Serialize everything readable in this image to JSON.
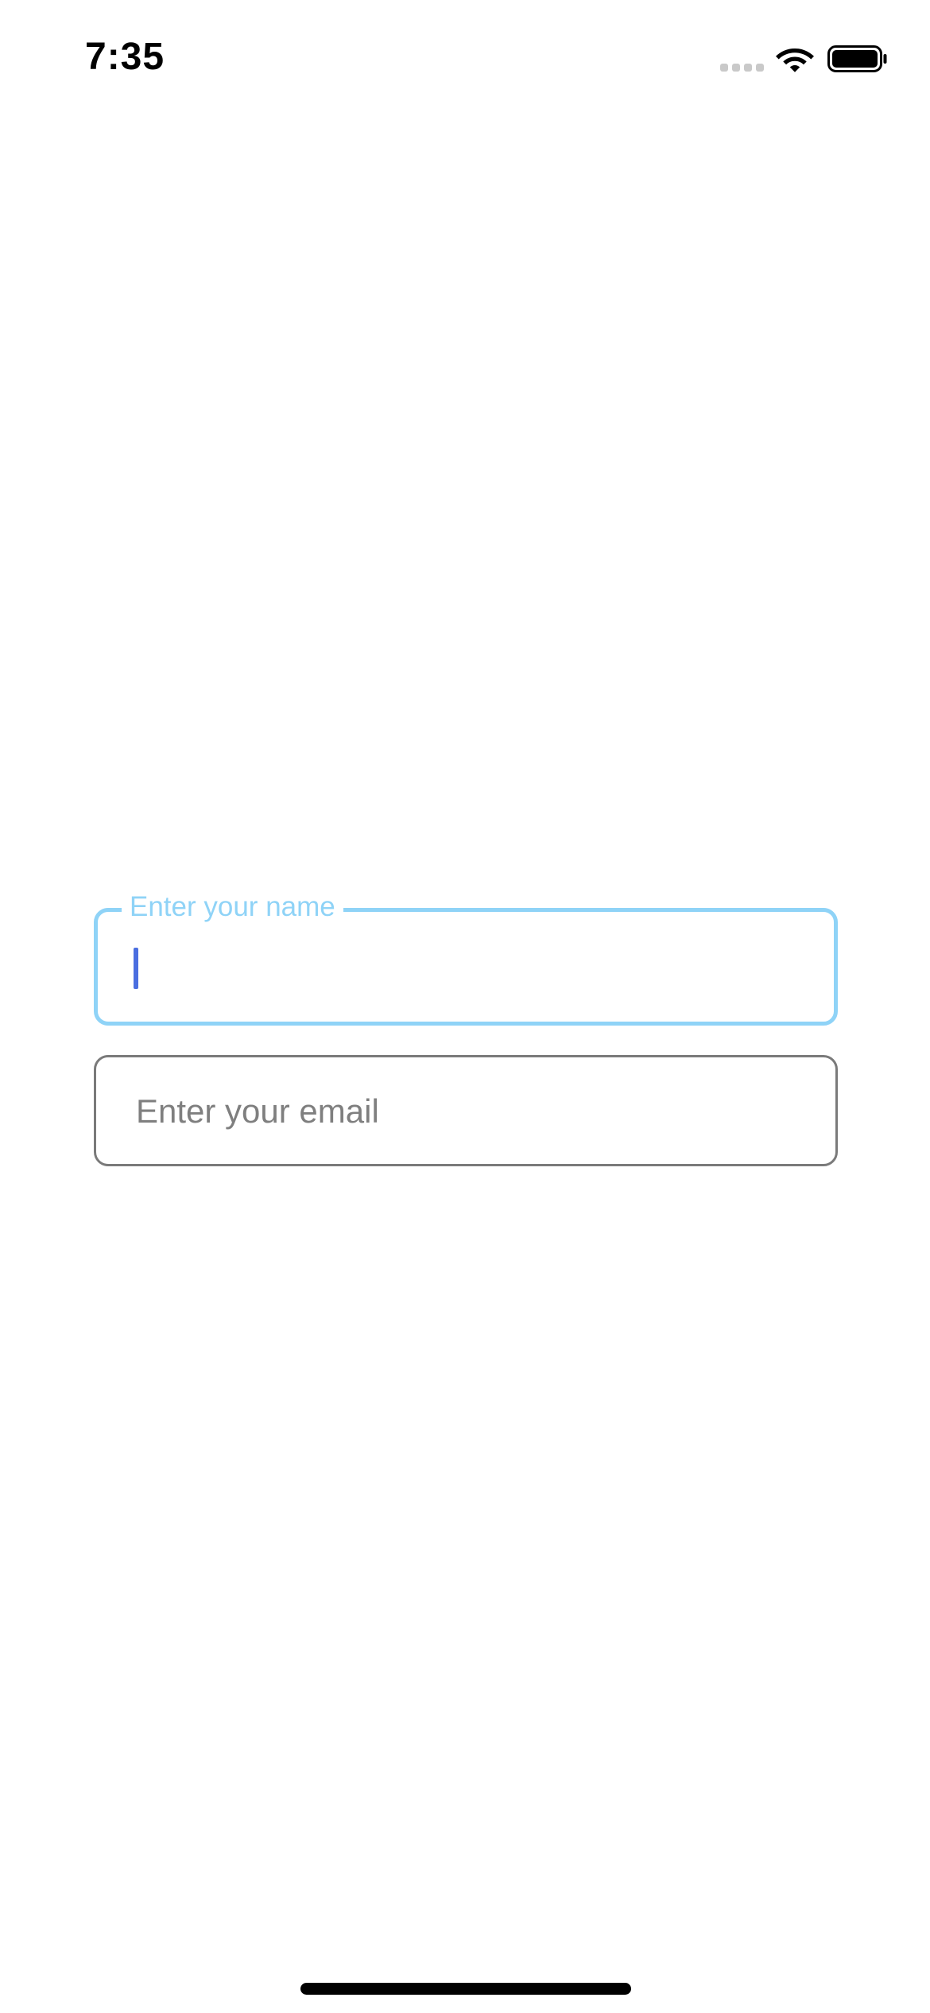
{
  "status_bar": {
    "time": "7:35",
    "signal_icon": "cellular-signal-icon",
    "wifi_icon": "wifi-icon",
    "battery_icon": "battery-icon"
  },
  "form": {
    "name_field": {
      "label": "Enter your name",
      "value": "",
      "focused": true,
      "accent_color": "#8fd3f7",
      "cursor_color": "#4a6ee0"
    },
    "email_field": {
      "placeholder": "Enter your email",
      "value": "",
      "border_color": "#7a7a7a"
    }
  }
}
